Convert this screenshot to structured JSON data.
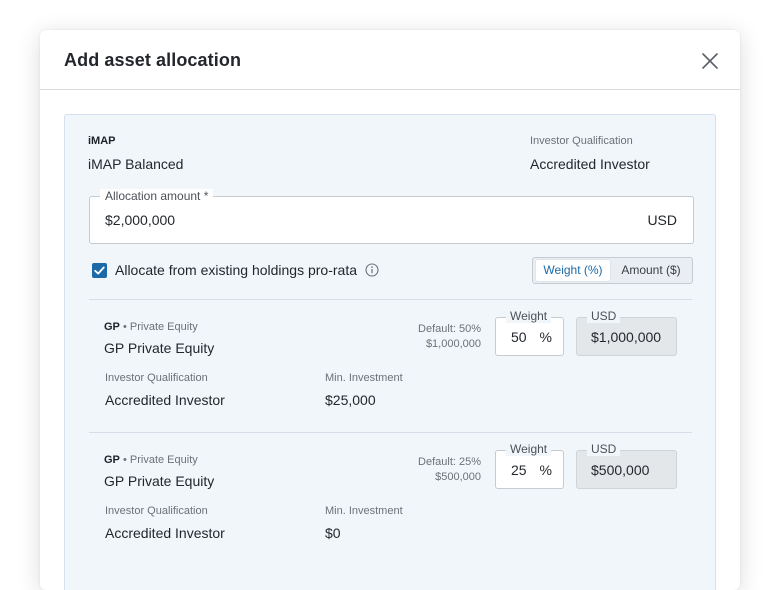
{
  "modal": {
    "title": "Add asset allocation",
    "close_icon": "close-icon"
  },
  "panel": {
    "model_label": "iMAP",
    "model_value": "iMAP Balanced",
    "qualification_label": "Investor Qualification",
    "qualification_value": "Accredited Investor",
    "allocation_amount": {
      "label": "Allocation amount *",
      "value": "$2,000,000",
      "currency": "USD"
    },
    "pro_rata": {
      "checked": true,
      "label": "Allocate from existing holdings pro-rata",
      "info_icon": "info-icon"
    },
    "mode_toggle": {
      "options": [
        "Weight (%)",
        "Amount ($)"
      ],
      "selected": "Weight (%)"
    }
  },
  "funds": [
    {
      "type_code": "GP",
      "type_separator": "•",
      "type_name": "Private Equity",
      "name": "GP Private Equity",
      "default_pct": "Default: 50%",
      "default_amount": "$1,000,000",
      "weight_label": "Weight",
      "weight_value": "50",
      "weight_unit": "%",
      "usd_label": "USD",
      "usd_value": "$1,000,000",
      "qualification_label": "Investor Qualification",
      "qualification_value": "Accredited Investor",
      "min_investment_label": "Min. Investment",
      "min_investment_value": "$25,000"
    },
    {
      "type_code": "GP",
      "type_separator": "•",
      "type_name": "Private Equity",
      "name": "GP Private Equity",
      "default_pct": "Default: 25%",
      "default_amount": "$500,000",
      "weight_label": "Weight",
      "weight_value": "25",
      "weight_unit": "%",
      "usd_label": "USD",
      "usd_value": "$500,000",
      "qualification_label": "Investor Qualification",
      "qualification_value": "Accredited Investor",
      "min_investment_label": "Min. Investment",
      "min_investment_value": "$0"
    }
  ],
  "colors": {
    "accent": "#1c6aa8",
    "panel_bg": "#f1f6fb",
    "readonly_bg": "#e4e7ea"
  }
}
